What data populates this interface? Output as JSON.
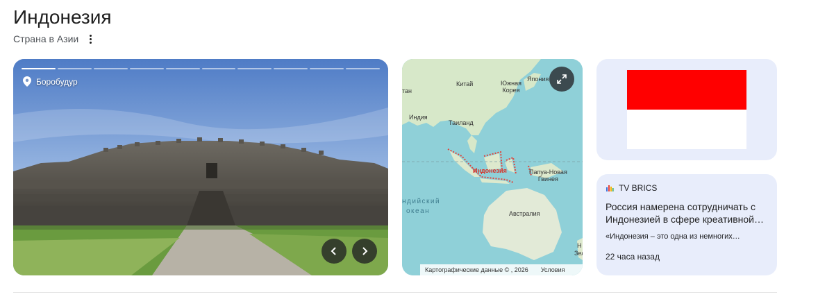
{
  "header": {
    "title": "Индонезия",
    "subtitle": "Страна в Азии",
    "more_icon": "more-vert-icon"
  },
  "photo": {
    "place_label": "Боробудур",
    "place_icon": "location-pin-icon",
    "slides_total": 10,
    "slides_active": 1,
    "prev_icon": "chevron-left-icon",
    "next_icon": "chevron-right-icon"
  },
  "map": {
    "labels": {
      "china": "Китай",
      "south_korea": "Южная\nКорея",
      "japan": "Япония",
      "stan": "тан",
      "india": "Индия",
      "thailand": "Таиланд",
      "indonesia": "Индонезия",
      "png": "Папуа-Новая\nГвинея",
      "indian_ocean_1": "ндийский",
      "indian_ocean_2": "океан",
      "australia": "Австралия",
      "nz_1": "Н",
      "nz_2": "Зел"
    },
    "attribution": "Картографические данные © , 2026",
    "terms": "Условия",
    "expand_icon": "expand-fullscreen-icon"
  },
  "flag": {
    "top_color": "#ff0000",
    "bottom_color": "#ffffff"
  },
  "news": {
    "source": "TV BRICS",
    "headline": "Россия намерена сотрудничать с Индонезией в сфере креативной…",
    "snippet": "«Индонезия – это одна из немногих…",
    "time": "22 часа назад"
  }
}
